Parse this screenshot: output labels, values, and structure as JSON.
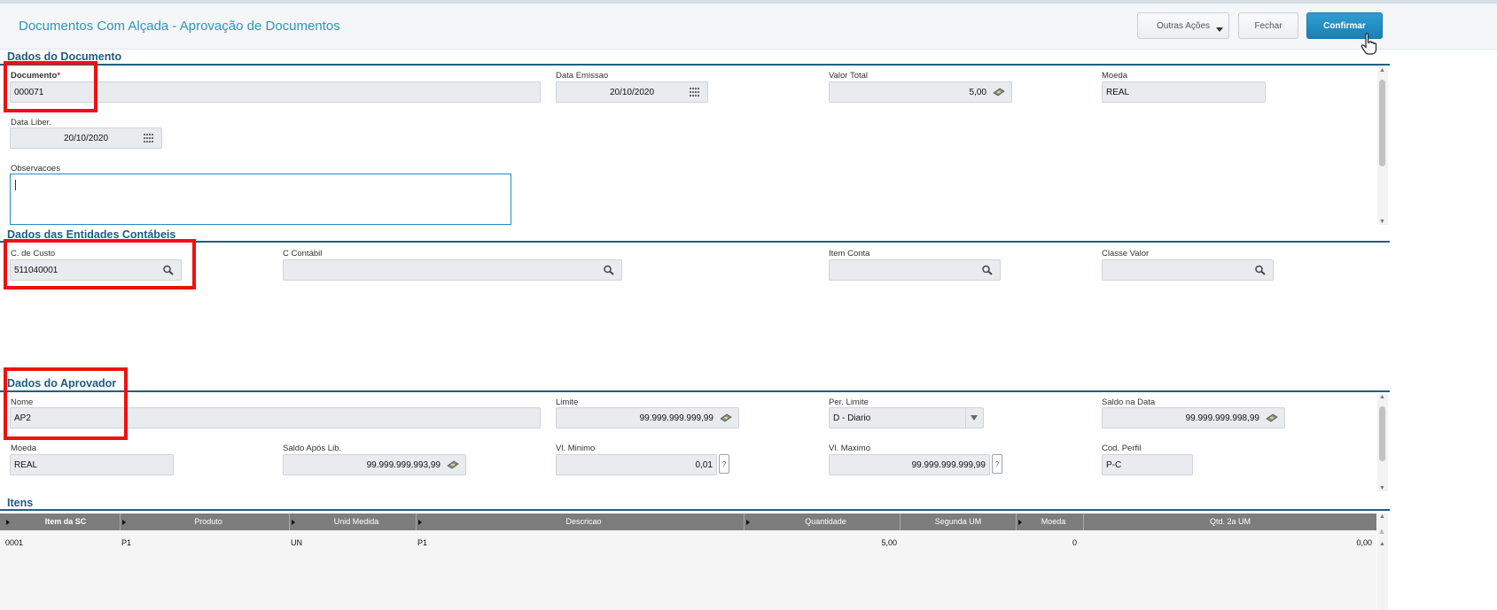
{
  "header": {
    "title": "Documentos Com Alçada - Aprovação de Documentos",
    "buttons": {
      "other_actions": "Outras Ações",
      "close": "Fechar",
      "confirm": "Confirmar"
    }
  },
  "document": {
    "section_title": "Dados do Documento",
    "documento": {
      "label": "Documento",
      "required_mark": "*",
      "value": "000071"
    },
    "data_emissao": {
      "label": "Data Emissao",
      "value": "20/10/2020"
    },
    "valor_total": {
      "label": "Valor Total",
      "value": "5,00"
    },
    "moeda": {
      "label": "Moeda",
      "value": "REAL"
    },
    "data_liber": {
      "label": "Data Liber.",
      "value": "20/10/2020"
    },
    "observacoes": {
      "label": "Observacoes",
      "value": ""
    }
  },
  "accounting": {
    "section_title": "Dados das Entidades Contábeis",
    "c_custo": {
      "label": "C. de Custo",
      "value": "511040001"
    },
    "c_contabil": {
      "label": "C Contábil",
      "value": ""
    },
    "item_conta": {
      "label": "Item Conta",
      "value": ""
    },
    "classe_valor": {
      "label": "Classe Valor",
      "value": ""
    }
  },
  "approver": {
    "section_title": "Dados do Aprovador",
    "nome": {
      "label": "Nome",
      "value": "AP2"
    },
    "limite": {
      "label": "Limite",
      "value": "99.999.999.999,99"
    },
    "per_limite": {
      "label": "Per. Limite",
      "value": "D - Diario"
    },
    "saldo_data": {
      "label": "Saldo na Data",
      "value": "99.999.999.998,99"
    },
    "moeda": {
      "label": "Moeda",
      "value": "REAL"
    },
    "saldo_apos": {
      "label": "Saldo Após Lib.",
      "value": "99.999.999.993,99"
    },
    "vl_minimo": {
      "label": "Vl. Minimo",
      "value": "0,01"
    },
    "vl_maximo": {
      "label": "Vl. Maximo",
      "value": "99.999.999.999,99"
    },
    "cod_perfil": {
      "label": "Cod. Perfil",
      "value": "P-C"
    },
    "help_glyph": "?"
  },
  "items": {
    "section_title": "Itens",
    "columns": [
      "Item da SC",
      "Produto",
      "Unid Medida",
      "Descricao",
      "Quantidade",
      "Segunda UM",
      "Moeda",
      "Qtd. 2a UM"
    ],
    "rows": [
      [
        "0001",
        "P1",
        "UN",
        "P1",
        "5,00",
        "",
        "0",
        "0,00"
      ]
    ]
  },
  "icons": {
    "calendar": "calendar-icon",
    "money": "money-icon",
    "search": "search-icon",
    "dropdown": "chevron-down-icon",
    "cursor": "hand-pointer-icon"
  },
  "colors": {
    "title": "#2e95b8",
    "section": "#1d5c84",
    "primary_button": "#1b7fb6",
    "highlight": "#ee1111",
    "grid_header": "#7d7d7d"
  }
}
